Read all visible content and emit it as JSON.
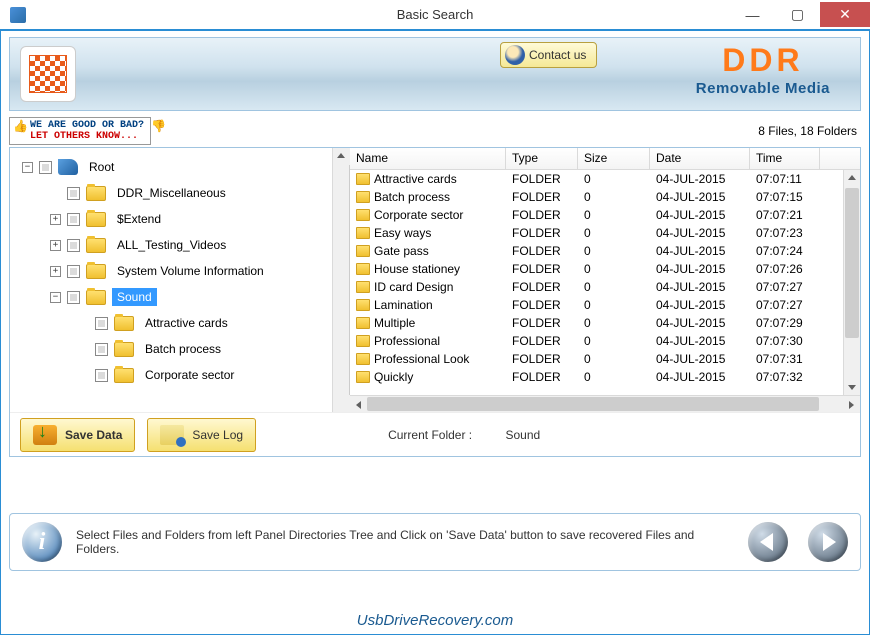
{
  "window": {
    "title": "Basic Search"
  },
  "header": {
    "contact_label": "Contact us",
    "brand": "DDR",
    "brand_sub": "Removable Media"
  },
  "feedback": {
    "line1": "WE ARE GOOD OR BAD?",
    "line2": "LET OTHERS KNOW..."
  },
  "summary": {
    "counts": "8 Files, 18 Folders"
  },
  "tree": {
    "nodes": [
      {
        "indent": 0,
        "toggle": "−",
        "check": true,
        "icon": "root",
        "label": "Root",
        "selected": false
      },
      {
        "indent": 1,
        "toggle": "",
        "check": true,
        "icon": "folder",
        "label": "DDR_Miscellaneous",
        "selected": false
      },
      {
        "indent": 1,
        "toggle": "+",
        "check": true,
        "icon": "folder",
        "label": "$Extend",
        "selected": false
      },
      {
        "indent": 1,
        "toggle": "+",
        "check": true,
        "icon": "folder",
        "label": "ALL_Testing_Videos",
        "selected": false
      },
      {
        "indent": 1,
        "toggle": "+",
        "check": true,
        "icon": "folder",
        "label": "System Volume Information",
        "selected": false
      },
      {
        "indent": 1,
        "toggle": "−",
        "check": true,
        "icon": "folder",
        "label": "Sound",
        "selected": true
      },
      {
        "indent": 2,
        "toggle": "",
        "check": true,
        "icon": "folder",
        "label": "Attractive cards",
        "selected": false
      },
      {
        "indent": 2,
        "toggle": "",
        "check": true,
        "icon": "folder",
        "label": "Batch process",
        "selected": false
      },
      {
        "indent": 2,
        "toggle": "",
        "check": true,
        "icon": "folder",
        "label": "Corporate sector",
        "selected": false
      }
    ]
  },
  "list": {
    "columns": {
      "name": "Name",
      "type": "Type",
      "size": "Size",
      "date": "Date",
      "time": "Time"
    },
    "rows": [
      {
        "name": "Attractive cards",
        "type": "FOLDER",
        "size": "0",
        "date": "04-JUL-2015",
        "time": "07:07:11"
      },
      {
        "name": "Batch process",
        "type": "FOLDER",
        "size": "0",
        "date": "04-JUL-2015",
        "time": "07:07:15"
      },
      {
        "name": "Corporate sector",
        "type": "FOLDER",
        "size": "0",
        "date": "04-JUL-2015",
        "time": "07:07:21"
      },
      {
        "name": "Easy ways",
        "type": "FOLDER",
        "size": "0",
        "date": "04-JUL-2015",
        "time": "07:07:23"
      },
      {
        "name": "Gate pass",
        "type": "FOLDER",
        "size": "0",
        "date": "04-JUL-2015",
        "time": "07:07:24"
      },
      {
        "name": "House stationey",
        "type": "FOLDER",
        "size": "0",
        "date": "04-JUL-2015",
        "time": "07:07:26"
      },
      {
        "name": "ID card Design",
        "type": "FOLDER",
        "size": "0",
        "date": "04-JUL-2015",
        "time": "07:07:27"
      },
      {
        "name": "Lamination",
        "type": "FOLDER",
        "size": "0",
        "date": "04-JUL-2015",
        "time": "07:07:27"
      },
      {
        "name": "Multiple",
        "type": "FOLDER",
        "size": "0",
        "date": "04-JUL-2015",
        "time": "07:07:29"
      },
      {
        "name": "Professional",
        "type": "FOLDER",
        "size": "0",
        "date": "04-JUL-2015",
        "time": "07:07:30"
      },
      {
        "name": "Professional Look",
        "type": "FOLDER",
        "size": "0",
        "date": "04-JUL-2015",
        "time": "07:07:31"
      },
      {
        "name": "Quickly",
        "type": "FOLDER",
        "size": "0",
        "date": "04-JUL-2015",
        "time": "07:07:32"
      }
    ]
  },
  "actions": {
    "save_data": "Save Data",
    "save_log": "Save Log"
  },
  "current": {
    "label": "Current Folder :",
    "value": "Sound"
  },
  "hint": {
    "text": "Select Files and Folders from left Panel Directories Tree and Click on 'Save Data' button to save recovered Files and Folders."
  },
  "footer": {
    "link": "UsbDriveRecovery.com"
  }
}
